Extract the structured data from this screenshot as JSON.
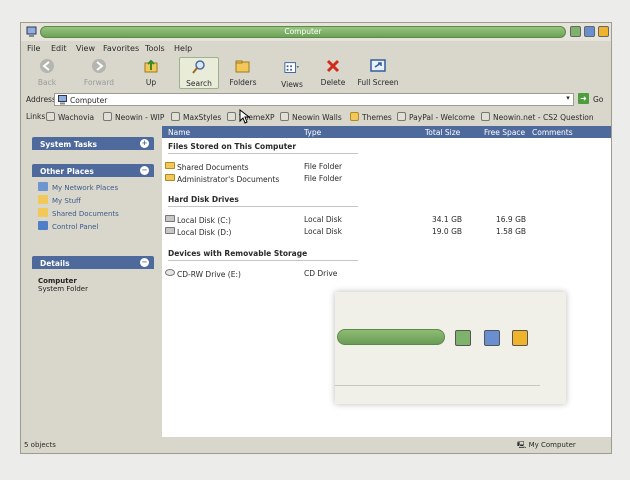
{
  "window": {
    "title": "Computer"
  },
  "menu": [
    "File",
    "Edit",
    "View",
    "Favorites",
    "Tools",
    "Help"
  ],
  "toolbar": {
    "back": "Back",
    "forward": "Forward",
    "up": "Up",
    "search": "Search",
    "folders": "Folders",
    "views": "Views",
    "delete": "Delete",
    "fullscreen": "Full Screen"
  },
  "address": {
    "label": "Address",
    "value": "Computer",
    "go": "Go"
  },
  "links": {
    "label": "Links",
    "items": [
      "Wachovia",
      "Neowin - WIP",
      "MaxStyles",
      "ThemeXP",
      "Neowin Walls",
      "Themes",
      "PayPal - Welcome",
      "Neowin.net - CS2 Question"
    ]
  },
  "tasks": {
    "system": {
      "title": "System Tasks"
    },
    "other": {
      "title": "Other Places",
      "items": [
        "My Network Places",
        "My Stuff",
        "Shared Documents",
        "Control Panel"
      ]
    },
    "details": {
      "title": "Details",
      "name": "Computer",
      "desc": "System Folder"
    }
  },
  "columns": {
    "name": "Name",
    "type": "Type",
    "total": "Total Size",
    "free": "Free Space",
    "comments": "Comments"
  },
  "groups": {
    "stored": "Files Stored on This Computer",
    "hdd": "Hard Disk Drives",
    "removable": "Devices with Removable Storage"
  },
  "rows": {
    "shared": {
      "name": "Shared Documents",
      "type": "File Folder"
    },
    "admin": {
      "name": "Administrator's Documents",
      "type": "File Folder"
    },
    "c": {
      "name": "Local Disk (C:)",
      "type": "Local Disk",
      "total": "34.1 GB",
      "free": "16.9 GB"
    },
    "d": {
      "name": "Local Disk (D:)",
      "type": "Local Disk",
      "total": "19.0 GB",
      "free": "1.58 GB"
    },
    "e": {
      "name": "CD-RW Drive (E:)",
      "type": "CD Drive"
    }
  },
  "status": {
    "left": "5 objects",
    "right": "My Computer"
  },
  "colors": {
    "accent": "#4e6a9c",
    "title_green": "#7aad63",
    "minimize": "#7fb26a",
    "maximize": "#6a8fd0",
    "close": "#f0b32c"
  }
}
